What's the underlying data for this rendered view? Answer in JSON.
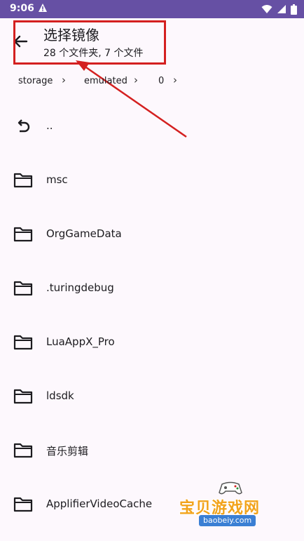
{
  "status_bar": {
    "time": "9:06",
    "icons": [
      "alert-icon",
      "wifi-icon",
      "signal-icon",
      "battery-icon"
    ]
  },
  "header": {
    "title": "选择镜像",
    "subtitle": "28 个文件夹, 7 个文件"
  },
  "breadcrumb": [
    "storage",
    "emulated",
    "0"
  ],
  "items": [
    {
      "label": "..",
      "icon": "undo-icon"
    },
    {
      "label": "msc",
      "icon": "folder-icon"
    },
    {
      "label": "OrgGameData",
      "icon": "folder-icon"
    },
    {
      "label": ".turingdebug",
      "icon": "folder-icon"
    },
    {
      "label": "LuaAppX_Pro",
      "icon": "folder-icon"
    },
    {
      "label": "ldsdk",
      "icon": "folder-icon"
    },
    {
      "label": "音乐剪辑",
      "icon": "folder-icon"
    },
    {
      "label": "ApplifierVideoCache",
      "icon": "folder-icon"
    }
  ],
  "watermark": {
    "text": "宝贝游戏网",
    "url": "baobeiy.com"
  },
  "colors": {
    "status_bar": "#6650a4",
    "annotation": "#d42020",
    "background": "#fdf8fd"
  }
}
